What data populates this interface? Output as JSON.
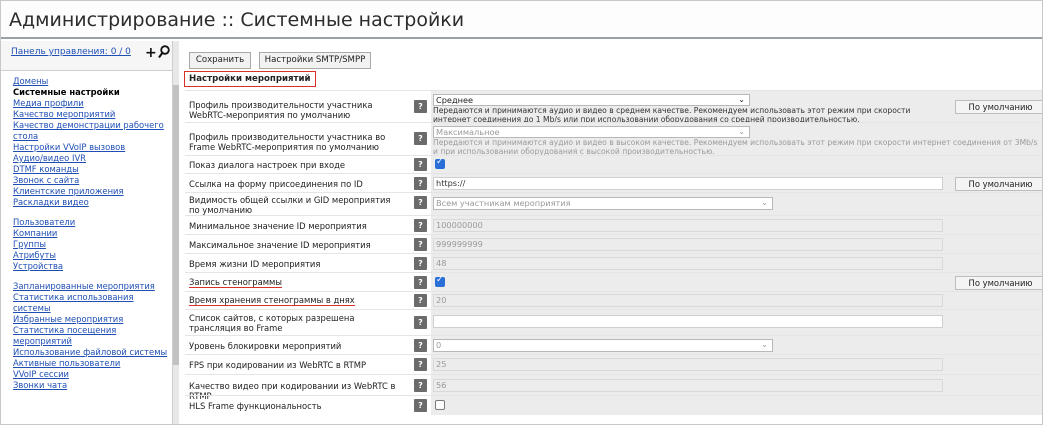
{
  "header": {
    "title": "Администрирование :: Системные настройки"
  },
  "sidebar": {
    "panel_link": "Панель управления: 0 / 0",
    "plus_icon": "plus-icon",
    "search_icon": "search-icon",
    "group1": [
      {
        "label": "Домены"
      },
      {
        "label": "Системные настройки",
        "active": true
      },
      {
        "label": "Медиа профили"
      },
      {
        "label": "Качество мероприятий"
      },
      {
        "label": "Качество демонстрации рабочего стола"
      },
      {
        "label": "Настройки VVoIP вызовов"
      },
      {
        "label": "Аудио/видео IVR"
      },
      {
        "label": "DTMF команды"
      },
      {
        "label": "Звонок с сайта"
      },
      {
        "label": "Клиентские приложения"
      },
      {
        "label": "Раскладки видео"
      }
    ],
    "group2": [
      {
        "label": "Пользователи"
      },
      {
        "label": "Компании"
      },
      {
        "label": "Группы"
      },
      {
        "label": "Атрибуты"
      },
      {
        "label": "Устройства"
      }
    ],
    "group3": [
      {
        "label": "Запланированные мероприятия"
      },
      {
        "label": "Статистика использования системы"
      },
      {
        "label": "Избранные мероприятия"
      },
      {
        "label": "Статистика посещения мероприятий"
      },
      {
        "label": "Использование файловой системы"
      },
      {
        "label": "Активные пользователи"
      },
      {
        "label": "VVoIP сессии"
      },
      {
        "label": "Звонки чата"
      }
    ]
  },
  "toolbar": {
    "save_label": "Сохранить",
    "smtp_label": "Настройки SMTP/SMPP"
  },
  "section": {
    "title": "Настройки мероприятий"
  },
  "help_glyph": "?",
  "default_label": "По умолчанию",
  "settings": {
    "webrtc_profile": {
      "label": "Профиль производительности участника WebRTC-мероприятия по умолчанию",
      "value": "Среднее",
      "description": "Передаются и принимаются аудио и видео в среднем качестве. Рекомендуем использовать этот режим при скорости интернет соединения до 1 Mb/s или при использовании оборудования со средней производительностью."
    },
    "frame_profile": {
      "label": "Профиль производительности участника во Frame WebRTC-мероприятия по умолчанию",
      "value": "Максимальное",
      "description": "Передаются и принимаются аудио и видео в высоком качестве. Рекомендуем использовать этот режим при скорости интернет соединения от 3Mb/s и при использовании оборудования с высокой производительностью."
    },
    "show_dialog": {
      "label": "Показ диалога настроек при входе",
      "checked": true
    },
    "join_link": {
      "label": "Ссылка на форму присоединения по ID",
      "value": "https://"
    },
    "link_visibility": {
      "label": "Видимость общей ссылки и GID мероприятия по умолчанию",
      "value": "Всем участникам мероприятия"
    },
    "min_id": {
      "label": "Минимальное значение ID мероприятия",
      "value": "100000000"
    },
    "max_id": {
      "label": "Максимальное значение ID мероприятия",
      "value": "999999999"
    },
    "id_lifetime": {
      "label": "Время жизни ID мероприятия",
      "value": "48"
    },
    "transcript": {
      "label": "Запись стенограммы",
      "checked": true
    },
    "transcript_days": {
      "label": "Время хранения стенограммы в днях",
      "value": "20"
    },
    "frame_sites": {
      "label": "Список сайтов, с которых разрешена трансляция во Frame",
      "value": ""
    },
    "block_level": {
      "label": "Уровень блокировки мероприятий",
      "value": "0"
    },
    "rtmp_fps": {
      "label": "FPS при кодировании из WebRTC в RTMP",
      "value": "25"
    },
    "rtmp_quality": {
      "label": "Качество видео при кодировании из WebRTC в RTMP",
      "value": "56"
    },
    "hls_frame": {
      "label": "HLS Frame функциональность",
      "checked": false
    }
  },
  "colors": {
    "accent_red": "#d9302a",
    "link_blue": "#1f4fb5",
    "checkbox_blue": "#2a6fd8"
  }
}
